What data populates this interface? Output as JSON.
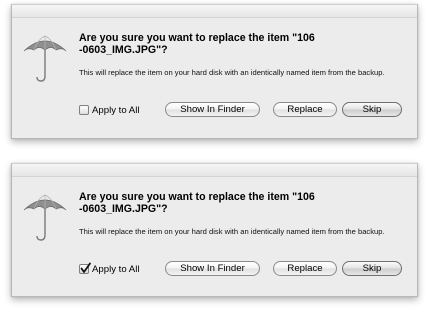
{
  "dialogs": [
    {
      "headline": "Are you sure you want to replace the item \"106 -0603_IMG.JPG\"?",
      "message": "This will replace the item on your hard disk with an identically named item from the backup.",
      "apply_to_all_label": "Apply to All",
      "apply_to_all_checked": false,
      "buttons": {
        "show_in_finder": "Show In Finder",
        "replace": "Replace",
        "skip": "Skip"
      },
      "icon": "umbrella-icon"
    },
    {
      "headline": "Are you sure you want to replace the item \"106 -0603_IMG.JPG\"?",
      "message": "This will replace the item on your hard disk with an identically named item from the backup.",
      "apply_to_all_label": "Apply to All",
      "apply_to_all_checked": true,
      "buttons": {
        "show_in_finder": "Show In Finder",
        "replace": "Replace",
        "skip": "Skip"
      },
      "icon": "umbrella-icon"
    }
  ],
  "colors": {
    "dialog_bg": "#ececec",
    "default_button": "#cccccc"
  }
}
